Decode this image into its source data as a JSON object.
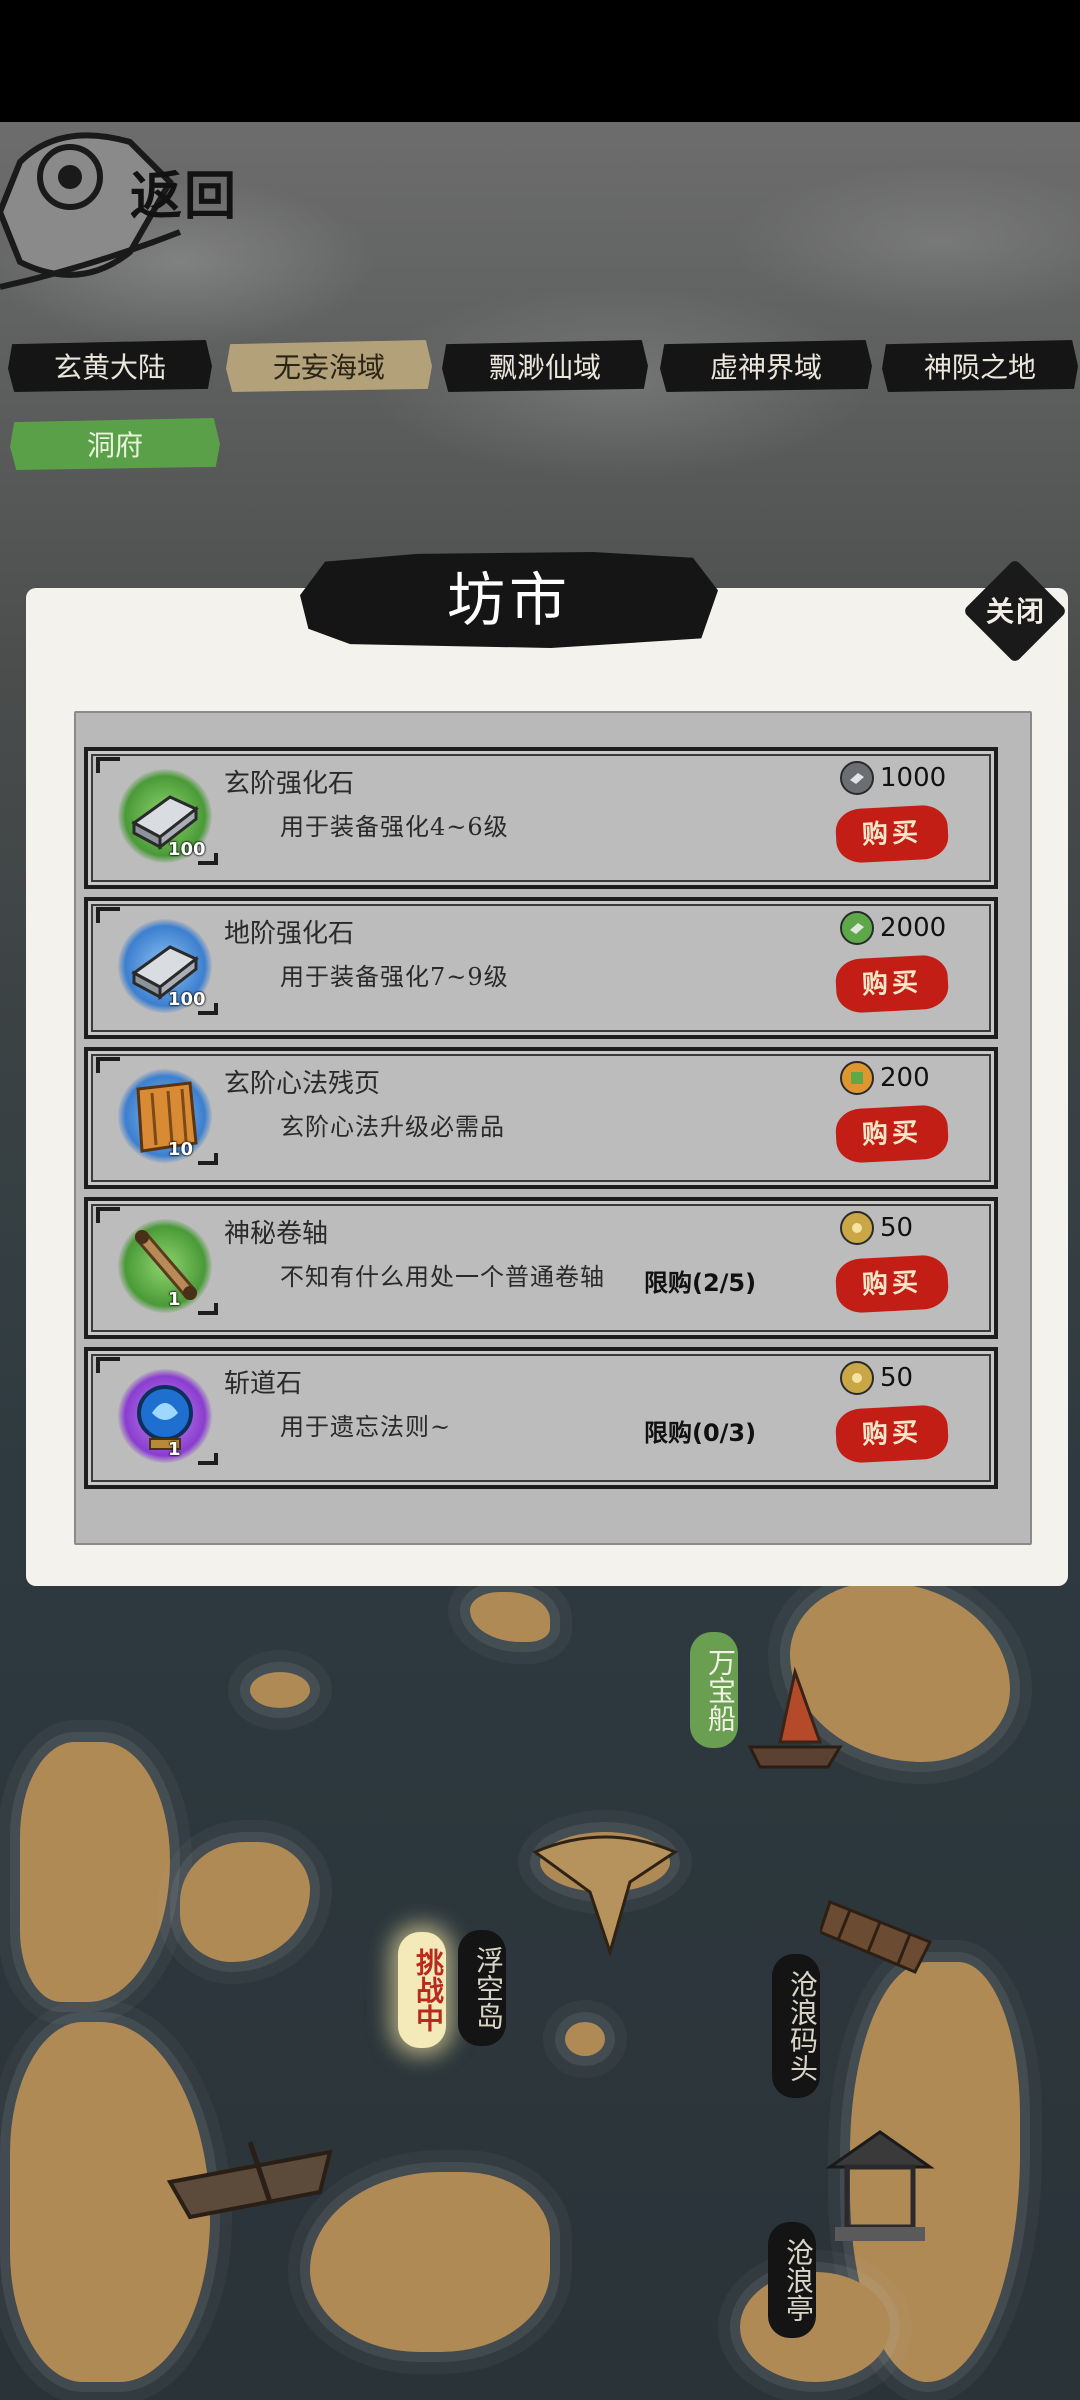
{
  "header": {
    "back_label": "返回"
  },
  "tabs": [
    {
      "label": "玄黄大陆",
      "active": false
    },
    {
      "label": "无妄海域",
      "active": true
    },
    {
      "label": "飘渺仙域",
      "active": false
    },
    {
      "label": "虚神界域",
      "active": false
    },
    {
      "label": "神陨之地",
      "active": false
    },
    {
      "label": "洞府",
      "active": false
    }
  ],
  "shop": {
    "title": "坊市",
    "close_label": "关闭",
    "items": [
      {
        "name": "玄阶强化石",
        "desc": "用于装备强化4~6级",
        "qty": "100",
        "price": "1000",
        "currency_icon": "silver-ore-icon",
        "limit": "",
        "buy_label": "购买",
        "glow": "#5fb14a"
      },
      {
        "name": "地阶强化石",
        "desc": "用于装备强化7~9级",
        "qty": "100",
        "price": "2000",
        "currency_icon": "green-ore-icon",
        "limit": "",
        "buy_label": "购买",
        "glow": "#4a8fd8"
      },
      {
        "name": "玄阶心法残页",
        "desc": "玄阶心法升级必需品",
        "qty": "10",
        "price": "200",
        "currency_icon": "jade-scroll-icon",
        "limit": "",
        "buy_label": "购买",
        "glow": "#4a8fd8"
      },
      {
        "name": "神秘卷轴",
        "desc": "不知有什么用处一个普通卷轴",
        "qty": "1",
        "price": "50",
        "currency_icon": "gold-coin-icon",
        "limit": "限购(2/5)",
        "buy_label": "购买",
        "glow": "#5fb14a"
      },
      {
        "name": "斩道石",
        "desc": "用于遗忘法则~",
        "qty": "1",
        "price": "50",
        "currency_icon": "gold-coin-icon",
        "limit": "限购(0/3)",
        "buy_label": "购买",
        "glow": "#a24ad8"
      }
    ]
  },
  "map": {
    "labels": [
      {
        "text": "万宝船",
        "style": "green"
      },
      {
        "text": "挑战中",
        "style": "challenge"
      },
      {
        "text": "浮空岛",
        "style": "dark"
      },
      {
        "text": "沧浪码头",
        "style": "dark"
      },
      {
        "text": "沧浪亭",
        "style": "dark"
      }
    ]
  }
}
